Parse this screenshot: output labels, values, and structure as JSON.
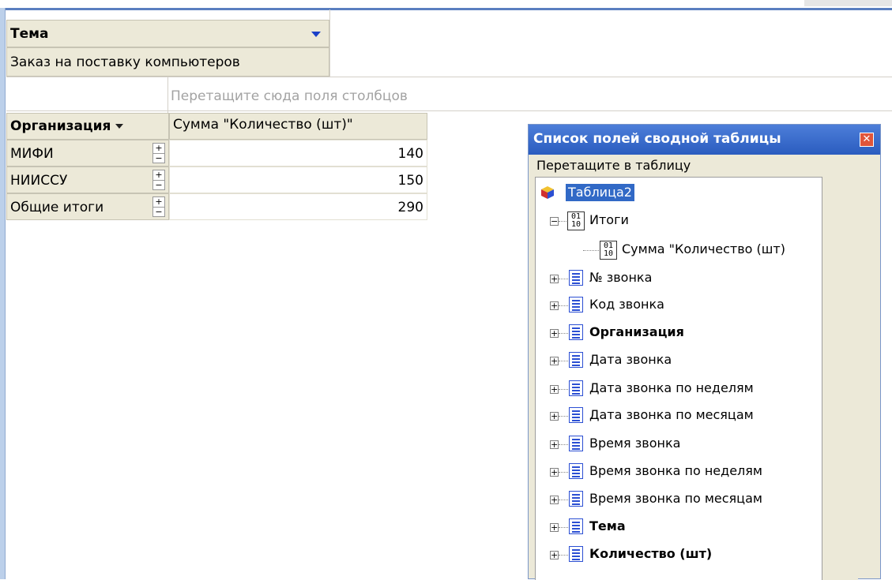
{
  "pivot": {
    "filter_field": "Тема",
    "filter_value": "Заказ на поставку компьютеров",
    "column_drop_hint": "Перетащите сюда поля столбцов",
    "row_field": "Организация",
    "data_field": "Сумма \"Количество (шт)\"",
    "rows": [
      {
        "label": "МИФИ",
        "value": "140"
      },
      {
        "label": "НИИССУ",
        "value": "150"
      },
      {
        "label": "Общие итоги",
        "value": "290"
      }
    ],
    "expand_symbol": "+",
    "collapse_symbol": "−"
  },
  "field_list": {
    "title": "Список полей сводной таблицы",
    "close_symbol": "✕",
    "subtitle": "Перетащите в таблицу",
    "root": "Таблица2",
    "totals_group": "Итоги",
    "totals_item": "Сумма \"Количество (шт)",
    "tree_expand": "+",
    "tree_collapse": "−",
    "fields": [
      {
        "label": "№ звонка",
        "bold": false
      },
      {
        "label": "Код звонка",
        "bold": false
      },
      {
        "label": "Организация",
        "bold": true
      },
      {
        "label": "Дата звонка",
        "bold": false
      },
      {
        "label": "Дата звонка по неделям",
        "bold": false
      },
      {
        "label": "Дата звонка по месяцам",
        "bold": false
      },
      {
        "label": "Время звонка",
        "bold": false
      },
      {
        "label": "Время звонка по неделям",
        "bold": false
      },
      {
        "label": "Время звонка по месяцам",
        "bold": false
      },
      {
        "label": "Тема",
        "bold": true
      },
      {
        "label": "Количество (шт)",
        "bold": true
      }
    ]
  }
}
